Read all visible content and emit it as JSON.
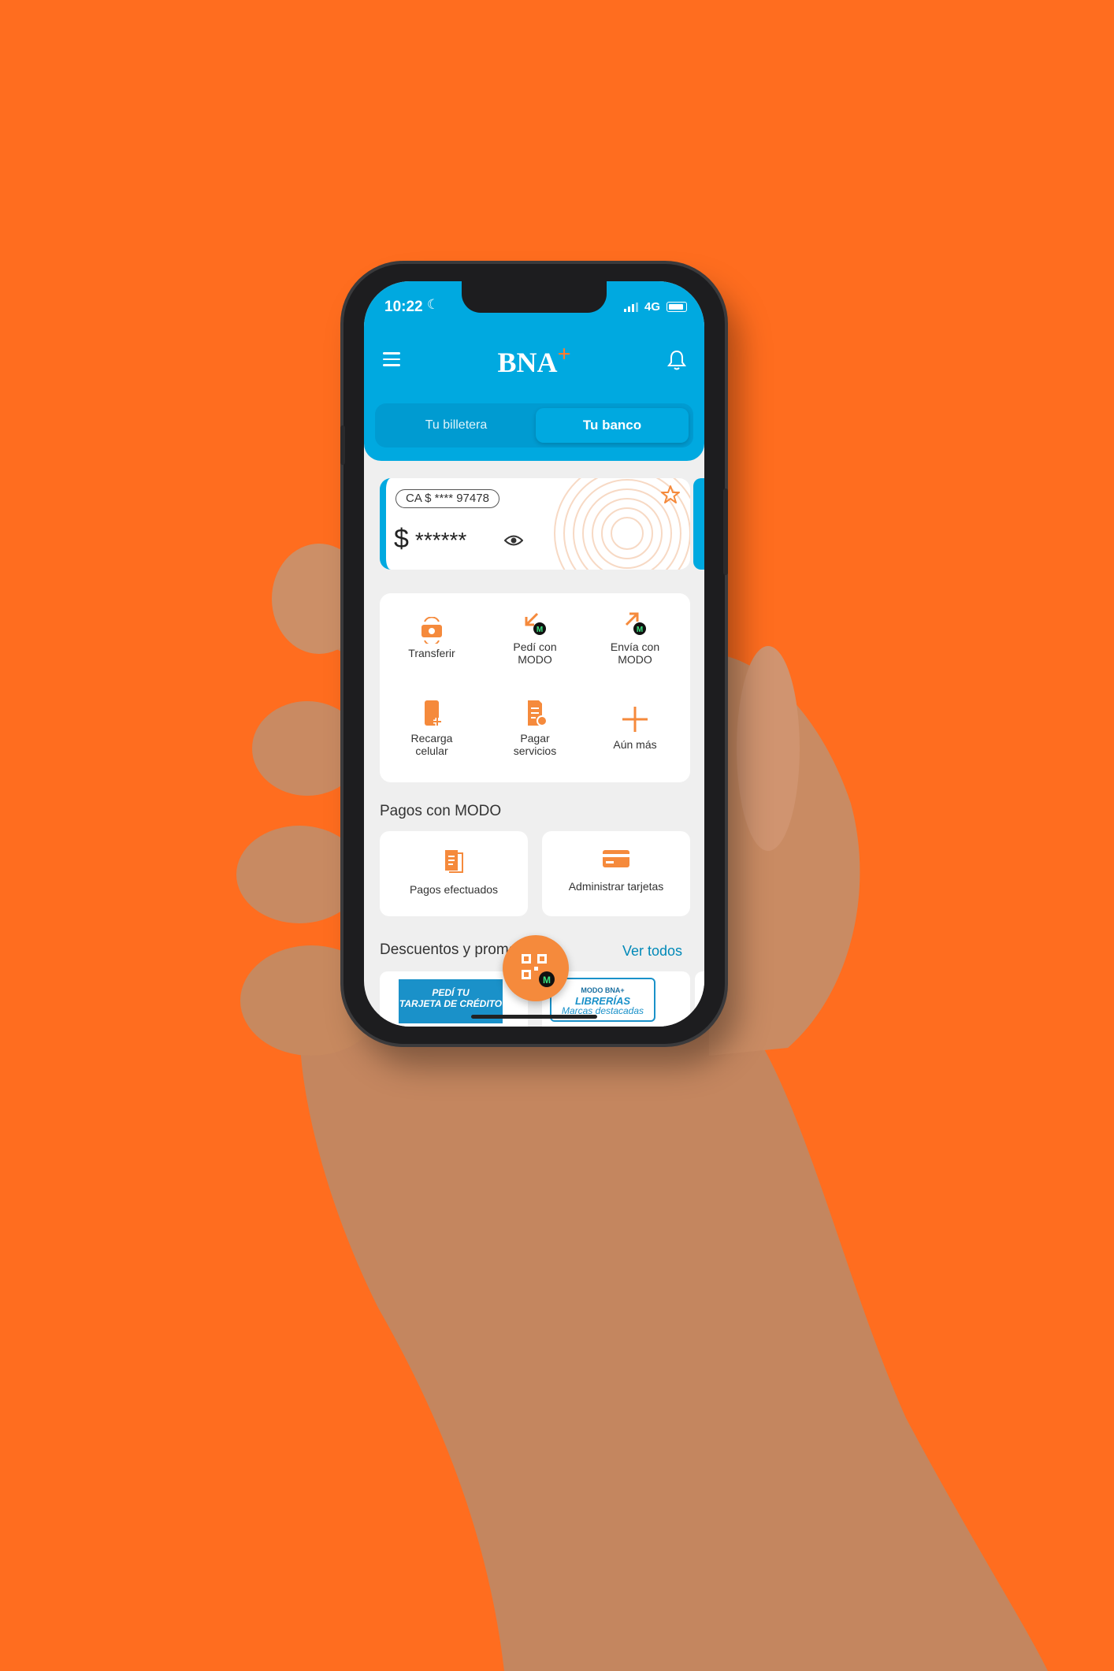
{
  "colors": {
    "background": "#ff6d1f",
    "brand_blue": "#00a9e0",
    "accent_orange": "#f58a3c"
  },
  "status_bar": {
    "time": "10:22",
    "network": "4G"
  },
  "header": {
    "logo_text": "BNA",
    "logo_mark": "+"
  },
  "tabs": [
    {
      "label": "Tu billetera",
      "selected": false
    },
    {
      "label": "Tu banco",
      "selected": true
    }
  ],
  "account": {
    "badge": "CA $ **** 97478",
    "currency": "$",
    "balance_masked": "******"
  },
  "actions": [
    {
      "label_1": "Transferir",
      "label_2": "",
      "icon": "transfer-icon"
    },
    {
      "label_1": "Pedí con",
      "label_2": "MODO",
      "icon": "request-modo-icon"
    },
    {
      "label_1": "Envía con",
      "label_2": "MODO",
      "icon": "send-modo-icon"
    },
    {
      "label_1": "Recarga",
      "label_2": "celular",
      "icon": "phone-recharge-icon"
    },
    {
      "label_1": "Pagar",
      "label_2": "servicios",
      "icon": "pay-services-icon"
    },
    {
      "label_1": "Aún más",
      "label_2": "",
      "icon": "plus-icon"
    }
  ],
  "modo_section": {
    "title": "Pagos con MODO",
    "cards": [
      {
        "label": "Pagos efectuados",
        "icon": "receipts-icon"
      },
      {
        "label": "Administrar tarjetas",
        "icon": "card-icon"
      }
    ]
  },
  "promos_section": {
    "title": "Descuentos y promociones",
    "see_all": "Ver todos",
    "promo_a": {
      "line_1": "PEDÍ TU",
      "line_2": "TARJETA DE CRÉDITO"
    },
    "promo_b": {
      "tag": "MODO BNA+",
      "line_1": "LIBRERÍAS",
      "line_2": "Marcas destacadas"
    }
  }
}
